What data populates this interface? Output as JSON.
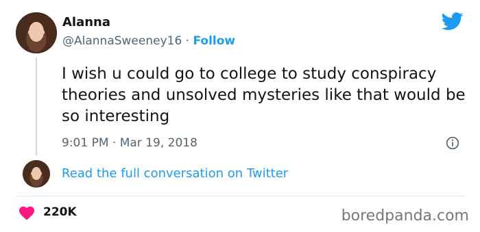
{
  "author": {
    "name": "Alanna",
    "handle": "@AlannaSweeney16",
    "separator": " · ",
    "follow_label": "Follow"
  },
  "tweet": {
    "text": "I wish u could go to college to study conspiracy theories and unsolved mysteries like that would be so interesting",
    "time": "9:01 PM · Mar 19, 2018"
  },
  "conversation_link": "Read the full conversation on Twitter",
  "likes": "220K",
  "watermark": "boredpanda.com",
  "icons": {
    "brand": "twitter-bird-icon",
    "info": "info-icon",
    "like": "heart-icon"
  },
  "colors": {
    "accent": "#1d9bf0",
    "heart": "#f91880",
    "secondary_text": "#536471"
  }
}
